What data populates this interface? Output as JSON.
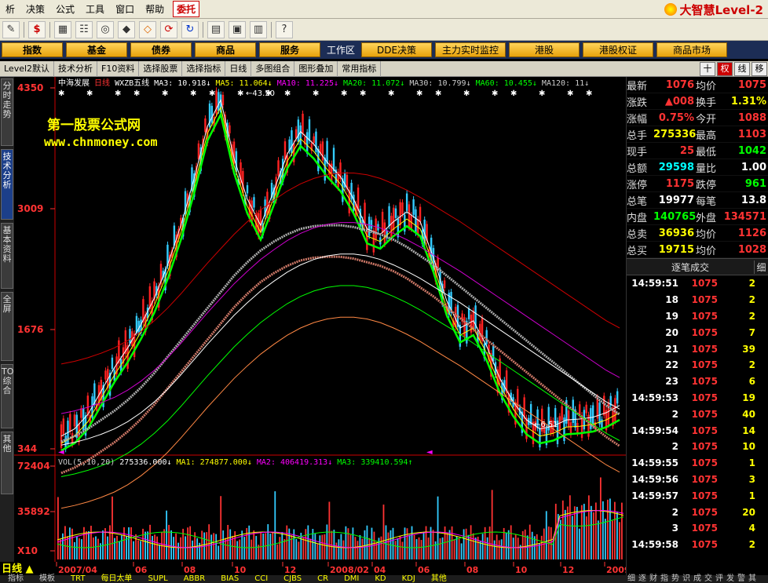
{
  "menubar": {
    "items": [
      "析",
      "决策",
      "公式",
      "工具",
      "窗口",
      "帮助"
    ],
    "entrust": "委托",
    "brand": "大智慧Level-2"
  },
  "categories": {
    "items": [
      "指数",
      "基金",
      "债券",
      "商品",
      "服务"
    ],
    "workzone": "工作区",
    "right_items": [
      "DDE决策",
      "主力实时监控",
      "港股",
      "港股权证",
      "商品市场"
    ]
  },
  "subtoolbar": {
    "items": [
      "Level2默认",
      "技术分析",
      "F10资料",
      "选择股票",
      "选择指标",
      "日线",
      "多图组合",
      "图形叠加",
      "常用指标"
    ],
    "right_items": [
      "十",
      "权",
      "线",
      "移"
    ]
  },
  "left_tabs": [
    "分时走势",
    "技术分析",
    "基本资料",
    "全屏",
    "TOP综合",
    "其他"
  ],
  "chart": {
    "stock_name": "中海发展",
    "period": "日线",
    "indicator_name": "WXZB五线",
    "ma_labels": [
      {
        "text": "MA3: 10.918",
        "color": "#ffffff"
      },
      {
        "text": "MA5: 11.064",
        "color": "#ffff00"
      },
      {
        "text": "MA10: 11.225",
        "color": "#ff00ff"
      },
      {
        "text": "MA20: 11.072",
        "color": "#00ff00"
      },
      {
        "text": "MA30: 10.799",
        "color": "#cccccc"
      },
      {
        "text": "MA60: 10.455",
        "color": "#00ff00"
      },
      {
        "text": "MA120: 11",
        "color": "#cccccc"
      }
    ],
    "price_ticks": [
      "4350",
      "3009",
      "1676",
      "344"
    ],
    "high_label": "43.50",
    "low_label": "6.51",
    "watermark_title": "第一股票公式网",
    "watermark_url": "www.chnmoney.com",
    "vol_header": {
      "name": "VOL(5,10,20)",
      "vol": "275336.000",
      "ma1": "MA1: 274877.000",
      "ma2": "MA2: 406419.313",
      "ma3": "MA3: 339410.594"
    },
    "vol_ticks": [
      "72404",
      "35892",
      "X10"
    ],
    "date_ticks": [
      "2007/04",
      "06",
      "08",
      "10",
      "12",
      "2008/02",
      "04",
      "06",
      "08",
      "10",
      "12",
      "2009/02"
    ],
    "period_label": "日线",
    "bottom_tabs": [
      "指标",
      "模板",
      "TRT",
      "每日太单",
      "SUPL",
      "ABBR",
      "BIAS",
      "CCI",
      "CJBS",
      "CR",
      "DMI",
      "KD",
      "KDJ",
      "其他"
    ]
  },
  "chart_data": {
    "type": "line",
    "title": "中海发展 日线",
    "x_range": [
      "2007/04",
      "2009/02"
    ],
    "ylim": [
      344,
      4350
    ],
    "series": [
      {
        "name": "MA3",
        "values": [
          520,
          600,
          760,
          1020,
          1280,
          1500,
          1760,
          2050,
          2420,
          2860,
          3380,
          3960,
          4250,
          3600,
          3150,
          2860,
          3250,
          3650,
          3900,
          3760,
          3560,
          3400,
          3150,
          2820,
          2760,
          2900,
          3010,
          2900,
          2500,
          2020,
          1720,
          1800,
          1520,
          1160,
          900,
          700,
          600,
          630,
          700,
          710,
          730,
          780,
          860
        ]
      },
      {
        "name": "MA60",
        "values": [
          460,
          520,
          600,
          700,
          800,
          920,
          1060,
          1220,
          1400,
          1580,
          1760,
          1940,
          2120,
          2300,
          2450,
          2580,
          2680,
          2760,
          2820,
          2850,
          2860,
          2860,
          2840,
          2800,
          2760,
          2700,
          2620,
          2520,
          2420,
          2300,
          2180,
          2060,
          1940,
          1820,
          1700,
          1580,
          1460,
          1340,
          1220,
          1100,
          980,
          860,
          760
        ]
      },
      {
        "name": "MA120",
        "values": [
          420,
          450,
          490,
          540,
          600,
          680,
          780,
          900,
          1040,
          1200,
          1370,
          1540,
          1700,
          1860,
          2000,
          2130,
          2240,
          2340,
          2420,
          2480,
          2520,
          2540,
          2540,
          2520,
          2480,
          2420,
          2350,
          2270,
          2180,
          2090,
          2000,
          1900,
          1800,
          1700,
          1600,
          1500,
          1400,
          1300,
          1200,
          1100,
          1000,
          900,
          820
        ]
      }
    ],
    "volume": {
      "ylim": [
        0,
        72404
      ]
    }
  },
  "quote": {
    "rows": [
      {
        "k1": "最新",
        "v1": "1076",
        "c1": "#ff3333",
        "k2": "均价",
        "v2": "1075",
        "c2": "#ff3333"
      },
      {
        "k1": "涨跌",
        "v1": "▲008",
        "c1": "#ff3333",
        "k2": "换手",
        "v2": "1.31%",
        "c2": "#ffff00"
      },
      {
        "k1": "涨幅",
        "v1": "0.75%",
        "c1": "#ff3333",
        "k2": "今开",
        "v2": "1088",
        "c2": "#ff3333"
      },
      {
        "k1": "总手",
        "v1": "275336",
        "c1": "#ffff00",
        "k2": "最高",
        "v2": "1103",
        "c2": "#ff3333"
      },
      {
        "k1": "现手",
        "v1": "25",
        "c1": "#ff3333",
        "k2": "最低",
        "v2": "1042",
        "c2": "#00ff00"
      },
      {
        "k1": "总额",
        "v1": "29598",
        "c1": "#00ffff",
        "k2": "量比",
        "v2": "1.00",
        "c2": "#ffffff"
      },
      {
        "k1": "涨停",
        "v1": "1175",
        "c1": "#ff3333",
        "k2": "跌停",
        "v2": "961",
        "c2": "#00ff00"
      },
      {
        "k1": "总笔",
        "v1": "19977",
        "c1": "#ffffff",
        "k2": "每笔",
        "v2": "13.8",
        "c2": "#ffffff"
      },
      {
        "k1": "内盘",
        "v1": "140765",
        "c1": "#00ff00",
        "k2": "外盘",
        "v2": "134571",
        "c2": "#ff3333"
      },
      {
        "k1": "总卖",
        "v1": "36936",
        "c1": "#ffff00",
        "k2": "均价",
        "v2": "1126",
        "c2": "#ff3333"
      },
      {
        "k1": "总买",
        "v1": "19715",
        "c1": "#ffff00",
        "k2": "均价",
        "v2": "1028",
        "c2": "#ff3333"
      }
    ],
    "trade_header": "逐笔成交",
    "trade_header_right": "细",
    "trades": [
      {
        "t": "14:59:51",
        "p": "1075",
        "v": "2"
      },
      {
        "t": "18",
        "p": "1075",
        "v": "2"
      },
      {
        "t": "19",
        "p": "1075",
        "v": "2"
      },
      {
        "t": "20",
        "p": "1075",
        "v": "7"
      },
      {
        "t": "21",
        "p": "1075",
        "v": "39"
      },
      {
        "t": "22",
        "p": "1075",
        "v": "2"
      },
      {
        "t": "23",
        "p": "1075",
        "v": "6"
      },
      {
        "t": "14:59:53",
        "p": "1075",
        "v": "19"
      },
      {
        "t": "2",
        "p": "1075",
        "v": "40"
      },
      {
        "t": "14:59:54",
        "p": "1075",
        "v": "14"
      },
      {
        "t": "2",
        "p": "1075",
        "v": "10"
      },
      {
        "t": "14:59:55",
        "p": "1075",
        "v": "1"
      },
      {
        "t": "14:59:56",
        "p": "1075",
        "v": "3"
      },
      {
        "t": "14:59:57",
        "p": "1075",
        "v": "1"
      },
      {
        "t": "2",
        "p": "1075",
        "v": "20"
      },
      {
        "t": "3",
        "p": "1075",
        "v": "4"
      },
      {
        "t": "14:59:58",
        "p": "1075",
        "v": "2"
      }
    ],
    "bottom_tabs": [
      "细",
      "逐",
      "财",
      "指",
      "势",
      "识",
      "成",
      "交",
      "评",
      "发",
      "警",
      "其"
    ]
  }
}
